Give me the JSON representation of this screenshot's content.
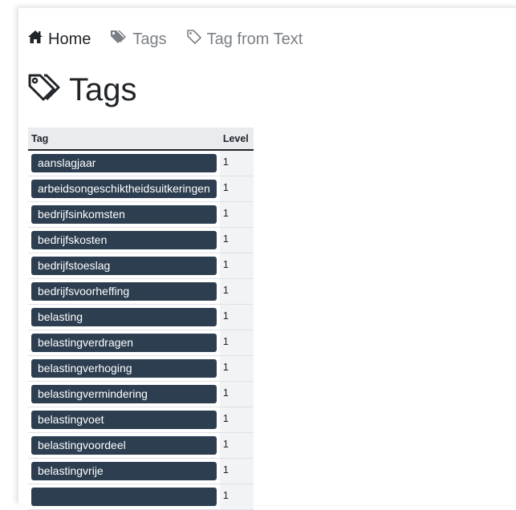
{
  "nav": {
    "items": [
      {
        "label": "Home",
        "icon": "home-icon"
      },
      {
        "label": "Tags",
        "icon": "tags-icon"
      },
      {
        "label": "Tag from Text",
        "icon": "tag-outline-icon"
      }
    ]
  },
  "page": {
    "title": "Tags",
    "title_icon": "tags-outline-icon"
  },
  "table": {
    "headers": [
      "Tag",
      "Level"
    ],
    "rows": [
      {
        "tag": "aanslagjaar",
        "level": "1"
      },
      {
        "tag": "arbeidsongeschiktheidsuitkeringen",
        "level": "1"
      },
      {
        "tag": "bedrijfsinkomsten",
        "level": "1"
      },
      {
        "tag": "bedrijfskosten",
        "level": "1"
      },
      {
        "tag": "bedrijfstoeslag",
        "level": "1"
      },
      {
        "tag": "bedrijfsvoorheffing",
        "level": "1"
      },
      {
        "tag": "belasting",
        "level": "1"
      },
      {
        "tag": "belastingverdragen",
        "level": "1"
      },
      {
        "tag": "belastingverhoging",
        "level": "1"
      },
      {
        "tag": "belastingvermindering",
        "level": "1"
      },
      {
        "tag": "belastingvoet",
        "level": "1"
      },
      {
        "tag": "belastingvoordeel",
        "level": "1"
      },
      {
        "tag": "belastingvrije",
        "level": "1"
      },
      {
        "tag": "",
        "level": "1"
      }
    ]
  },
  "colors": {
    "badge_bg": "#2c3e50",
    "header_bg": "#e9ecef",
    "muted_nav": "#7a7f85"
  }
}
